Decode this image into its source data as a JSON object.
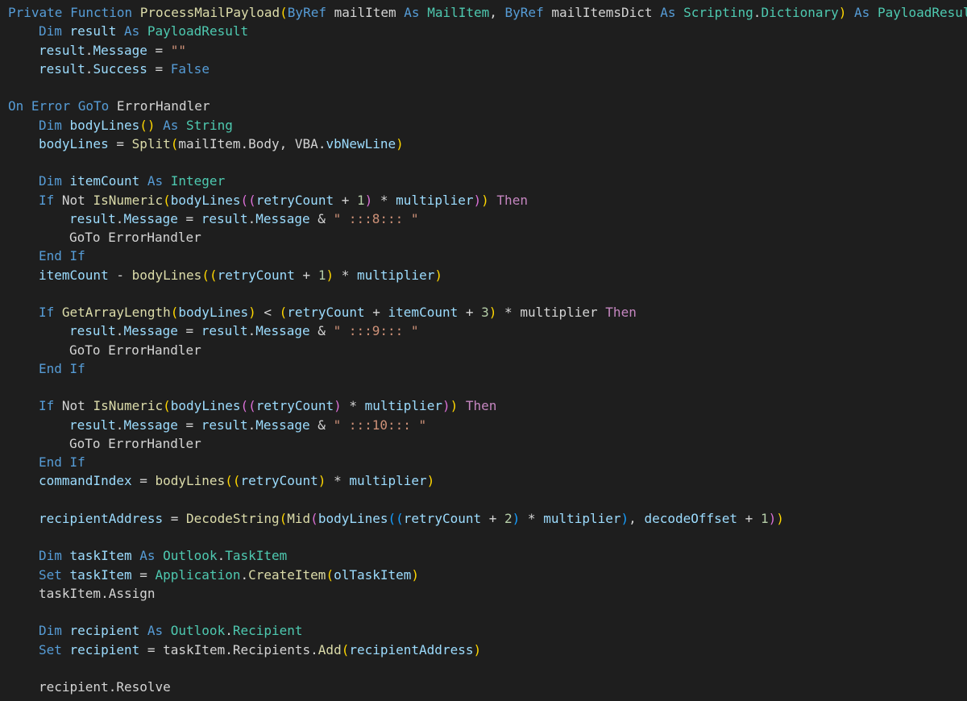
{
  "editor": {
    "lines": [
      {
        "indent": 0,
        "tokens": [
          [
            "k",
            "Private "
          ],
          [
            "k",
            "Function "
          ],
          [
            "f",
            "ProcessMailPayload"
          ],
          [
            "p",
            "("
          ],
          [
            "k",
            "ByRef "
          ],
          [
            "vb",
            "mailItem "
          ],
          [
            "k",
            "As "
          ],
          [
            "t",
            "MailItem"
          ],
          [
            "o",
            ", "
          ],
          [
            "k",
            "ByRef "
          ],
          [
            "vb",
            "mailItemsDict "
          ],
          [
            "k",
            "As "
          ],
          [
            "t",
            "Scripting"
          ],
          [
            "o",
            "."
          ],
          [
            "t",
            "Dictionary"
          ],
          [
            "p",
            ")"
          ],
          [
            "o",
            " "
          ],
          [
            "k",
            "As "
          ],
          [
            "t",
            "PayloadResult"
          ]
        ]
      },
      {
        "indent": 1,
        "tokens": [
          [
            "k",
            "Dim "
          ],
          [
            "v",
            "result "
          ],
          [
            "k",
            "As "
          ],
          [
            "t",
            "PayloadResult"
          ]
        ]
      },
      {
        "indent": 1,
        "tokens": [
          [
            "v",
            "result"
          ],
          [
            "o",
            "."
          ],
          [
            "v",
            "Message"
          ],
          [
            "o",
            " = "
          ],
          [
            "s",
            "\"\""
          ]
        ]
      },
      {
        "indent": 1,
        "tokens": [
          [
            "v",
            "result"
          ],
          [
            "o",
            "."
          ],
          [
            "v",
            "Success"
          ],
          [
            "o",
            " = "
          ],
          [
            "k",
            "False"
          ]
        ]
      },
      {
        "indent": 0,
        "tokens": []
      },
      {
        "indent": 0,
        "tokens": [
          [
            "k",
            "On "
          ],
          [
            "k",
            "Error "
          ],
          [
            "k",
            "GoTo "
          ],
          [
            "vb",
            "ErrorHandler"
          ]
        ]
      },
      {
        "indent": 1,
        "tokens": [
          [
            "k",
            "Dim "
          ],
          [
            "v",
            "bodyLines"
          ],
          [
            "p",
            "()"
          ],
          [
            "o",
            " "
          ],
          [
            "k",
            "As "
          ],
          [
            "t",
            "String"
          ]
        ]
      },
      {
        "indent": 1,
        "tokens": [
          [
            "v",
            "bodyLines"
          ],
          [
            "o",
            " = "
          ],
          [
            "f",
            "Split"
          ],
          [
            "p",
            "("
          ],
          [
            "vb",
            "mailItem.Body, VBA."
          ],
          [
            "v",
            "vbNewLine"
          ],
          [
            "p",
            ")"
          ]
        ]
      },
      {
        "indent": 0,
        "tokens": []
      },
      {
        "indent": 1,
        "tokens": [
          [
            "k",
            "Dim "
          ],
          [
            "v",
            "itemCount "
          ],
          [
            "k",
            "As "
          ],
          [
            "t",
            "Integer"
          ]
        ]
      },
      {
        "indent": 1,
        "tokens": [
          [
            "k",
            "If "
          ],
          [
            "vb",
            "Not "
          ],
          [
            "f",
            "IsNumeric"
          ],
          [
            "p",
            "("
          ],
          [
            "v",
            "bodyLines"
          ],
          [
            "p2",
            "(("
          ],
          [
            "v",
            "retryCount"
          ],
          [
            "o",
            " + "
          ],
          [
            "n",
            "1"
          ],
          [
            "p2",
            ")"
          ],
          [
            "o",
            " * "
          ],
          [
            "v",
            "multiplier"
          ],
          [
            "p2",
            ")"
          ],
          [
            "p",
            ")"
          ],
          [
            "o",
            " "
          ],
          [
            "kp",
            "Then"
          ]
        ]
      },
      {
        "indent": 2,
        "tokens": [
          [
            "v",
            "result"
          ],
          [
            "o",
            "."
          ],
          [
            "v",
            "Message"
          ],
          [
            "o",
            " = "
          ],
          [
            "v",
            "result"
          ],
          [
            "o",
            "."
          ],
          [
            "v",
            "Message"
          ],
          [
            "o",
            " & "
          ],
          [
            "s",
            "\" :::8::: \""
          ]
        ]
      },
      {
        "indent": 2,
        "tokens": [
          [
            "vb",
            "GoTo "
          ],
          [
            "vb",
            "ErrorHandler"
          ]
        ]
      },
      {
        "indent": 1,
        "tokens": [
          [
            "k",
            "End "
          ],
          [
            "k",
            "If"
          ]
        ]
      },
      {
        "indent": 1,
        "tokens": [
          [
            "v",
            "itemCount"
          ],
          [
            "o",
            " - "
          ],
          [
            "f",
            "bodyLines"
          ],
          [
            "p",
            "(("
          ],
          [
            "v",
            "retryCount"
          ],
          [
            "o",
            " + "
          ],
          [
            "n",
            "1"
          ],
          [
            "p",
            ")"
          ],
          [
            "o",
            " * "
          ],
          [
            "v",
            "multiplier"
          ],
          [
            "p",
            ")"
          ]
        ]
      },
      {
        "indent": 0,
        "tokens": []
      },
      {
        "indent": 1,
        "tokens": [
          [
            "k",
            "If "
          ],
          [
            "f",
            "GetArrayLength"
          ],
          [
            "p",
            "("
          ],
          [
            "v",
            "bodyLines"
          ],
          [
            "p",
            ")"
          ],
          [
            "o",
            " < "
          ],
          [
            "p",
            "("
          ],
          [
            "v",
            "retryCount"
          ],
          [
            "o",
            " + "
          ],
          [
            "v",
            "itemCount"
          ],
          [
            "o",
            " + "
          ],
          [
            "n",
            "3"
          ],
          [
            "p",
            ")"
          ],
          [
            "o",
            " * "
          ],
          [
            "vb",
            "multiplier "
          ],
          [
            "kp",
            "Then"
          ]
        ]
      },
      {
        "indent": 2,
        "tokens": [
          [
            "v",
            "result"
          ],
          [
            "o",
            "."
          ],
          [
            "v",
            "Message"
          ],
          [
            "o",
            " = "
          ],
          [
            "v",
            "result"
          ],
          [
            "o",
            "."
          ],
          [
            "v",
            "Message"
          ],
          [
            "o",
            " & "
          ],
          [
            "s",
            "\" :::9::: \""
          ]
        ]
      },
      {
        "indent": 2,
        "tokens": [
          [
            "vb",
            "GoTo "
          ],
          [
            "vb",
            "ErrorHandler"
          ]
        ]
      },
      {
        "indent": 1,
        "tokens": [
          [
            "k",
            "End "
          ],
          [
            "k",
            "If"
          ]
        ]
      },
      {
        "indent": 0,
        "tokens": []
      },
      {
        "indent": 1,
        "tokens": [
          [
            "k",
            "If "
          ],
          [
            "vb",
            "Not "
          ],
          [
            "f",
            "IsNumeric"
          ],
          [
            "p",
            "("
          ],
          [
            "v",
            "bodyLines"
          ],
          [
            "p2",
            "(("
          ],
          [
            "v",
            "retryCount"
          ],
          [
            "p2",
            ")"
          ],
          [
            "o",
            " * "
          ],
          [
            "v",
            "multiplier"
          ],
          [
            "p2",
            ")"
          ],
          [
            "p",
            ")"
          ],
          [
            "o",
            " "
          ],
          [
            "kp",
            "Then"
          ]
        ]
      },
      {
        "indent": 2,
        "tokens": [
          [
            "v",
            "result"
          ],
          [
            "o",
            "."
          ],
          [
            "v",
            "Message"
          ],
          [
            "o",
            " = "
          ],
          [
            "v",
            "result"
          ],
          [
            "o",
            "."
          ],
          [
            "v",
            "Message"
          ],
          [
            "o",
            " & "
          ],
          [
            "s",
            "\" :::10::: \""
          ]
        ]
      },
      {
        "indent": 2,
        "tokens": [
          [
            "vb",
            "GoTo "
          ],
          [
            "vb",
            "ErrorHandler"
          ]
        ]
      },
      {
        "indent": 1,
        "tokens": [
          [
            "k",
            "End "
          ],
          [
            "k",
            "If"
          ]
        ]
      },
      {
        "indent": 1,
        "tokens": [
          [
            "v",
            "commandIndex"
          ],
          [
            "o",
            " = "
          ],
          [
            "f",
            "bodyLines"
          ],
          [
            "p",
            "(("
          ],
          [
            "v",
            "retryCount"
          ],
          [
            "p",
            ")"
          ],
          [
            "o",
            " * "
          ],
          [
            "v",
            "multiplier"
          ],
          [
            "p",
            ")"
          ]
        ]
      },
      {
        "indent": 0,
        "tokens": []
      },
      {
        "indent": 1,
        "tokens": [
          [
            "v",
            "recipientAddress"
          ],
          [
            "o",
            " = "
          ],
          [
            "f",
            "DecodeString"
          ],
          [
            "p",
            "("
          ],
          [
            "f",
            "Mid"
          ],
          [
            "p2",
            "("
          ],
          [
            "v",
            "bodyLines"
          ],
          [
            "p3",
            "(("
          ],
          [
            "v",
            "retryCount"
          ],
          [
            "o",
            " + "
          ],
          [
            "n",
            "2"
          ],
          [
            "p3",
            ")"
          ],
          [
            "o",
            " * "
          ],
          [
            "v",
            "multiplier"
          ],
          [
            "p3",
            ")"
          ],
          [
            "o",
            ", "
          ],
          [
            "v",
            "decodeOffset"
          ],
          [
            "o",
            " + "
          ],
          [
            "n",
            "1"
          ],
          [
            "p2",
            ")"
          ],
          [
            "p",
            ")"
          ]
        ]
      },
      {
        "indent": 0,
        "tokens": []
      },
      {
        "indent": 1,
        "tokens": [
          [
            "k",
            "Dim "
          ],
          [
            "v",
            "taskItem "
          ],
          [
            "k",
            "As "
          ],
          [
            "t",
            "Outlook"
          ],
          [
            "o",
            "."
          ],
          [
            "t",
            "TaskItem"
          ]
        ]
      },
      {
        "indent": 1,
        "tokens": [
          [
            "k",
            "Set "
          ],
          [
            "v",
            "taskItem"
          ],
          [
            "o",
            " = "
          ],
          [
            "t",
            "Application"
          ],
          [
            "o",
            "."
          ],
          [
            "f",
            "CreateItem"
          ],
          [
            "p",
            "("
          ],
          [
            "v",
            "olTaskItem"
          ],
          [
            "p",
            ")"
          ]
        ]
      },
      {
        "indent": 1,
        "tokens": [
          [
            "vb",
            "taskItem.Assign"
          ]
        ]
      },
      {
        "indent": 0,
        "tokens": []
      },
      {
        "indent": 1,
        "tokens": [
          [
            "k",
            "Dim "
          ],
          [
            "v",
            "recipient "
          ],
          [
            "k",
            "As "
          ],
          [
            "t",
            "Outlook"
          ],
          [
            "o",
            "."
          ],
          [
            "t",
            "Recipient"
          ]
        ]
      },
      {
        "indent": 1,
        "tokens": [
          [
            "k",
            "Set "
          ],
          [
            "v",
            "recipient"
          ],
          [
            "o",
            " = "
          ],
          [
            "vb",
            "taskItem.Recipients."
          ],
          [
            "f",
            "Add"
          ],
          [
            "p",
            "("
          ],
          [
            "v",
            "recipientAddress"
          ],
          [
            "p",
            ")"
          ]
        ]
      },
      {
        "indent": 0,
        "tokens": []
      },
      {
        "indent": 1,
        "tokens": [
          [
            "vb",
            "recipient.Resolve"
          ]
        ]
      }
    ]
  }
}
